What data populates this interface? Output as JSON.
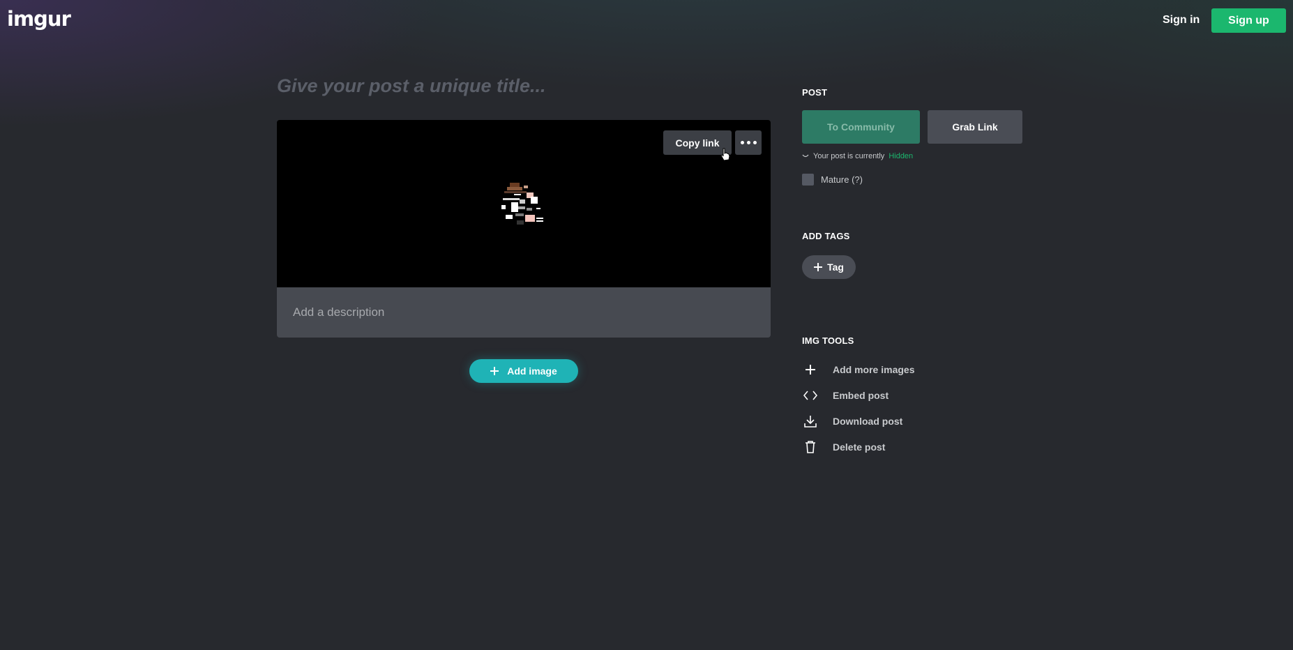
{
  "header": {
    "logo_text": "imgur",
    "sign_in": "Sign in",
    "sign_up": "Sign up"
  },
  "post": {
    "title_placeholder": "Give your post a unique title...",
    "copy_link": "Copy link",
    "description_placeholder": "Add a description",
    "add_image": "Add image"
  },
  "sidebar": {
    "post_label": "POST",
    "to_community": "To Community",
    "grab_link": "Grab Link",
    "status_prefix": "Your post is currently",
    "status_value": "Hidden",
    "mature_label": "Mature (?)",
    "add_tags_label": "ADD TAGS",
    "tag_button": "Tag",
    "img_tools_label": "IMG TOOLS",
    "tools": [
      {
        "label": "Add more images",
        "icon": "plus-icon"
      },
      {
        "label": "Embed post",
        "icon": "code-icon"
      },
      {
        "label": "Download post",
        "icon": "download-icon"
      },
      {
        "label": "Delete post",
        "icon": "trash-icon"
      }
    ]
  },
  "colors": {
    "background": "#27292e",
    "brand_green": "#1bb76e",
    "teal_button": "#1fb3b6"
  }
}
